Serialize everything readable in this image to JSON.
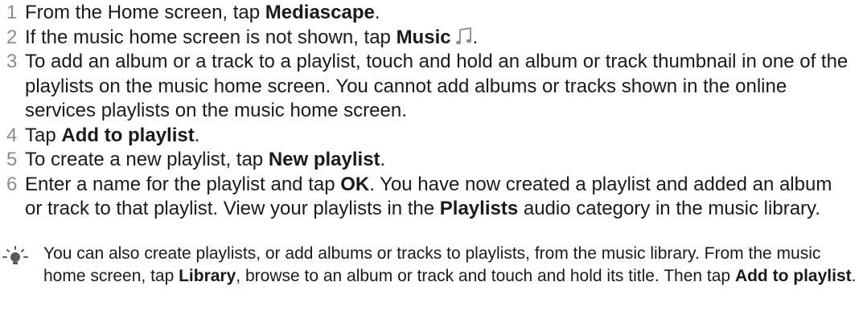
{
  "steps": [
    {
      "num": "1",
      "parts": [
        {
          "t": "From the Home screen, tap "
        },
        {
          "t": "Mediascape",
          "b": true
        },
        {
          "t": "."
        }
      ]
    },
    {
      "num": "2",
      "parts": [
        {
          "t": "If the music home screen is not shown, tap "
        },
        {
          "t": "Music",
          "b": true
        },
        {
          "icon": "music-note-icon"
        },
        {
          "t": "."
        }
      ]
    },
    {
      "num": "3",
      "parts": [
        {
          "t": "To add an album or a track to a playlist, touch and hold an album or track thumbnail in one of the playlists on the music home screen. You cannot add albums or tracks shown in the online services playlists on the music home screen."
        }
      ]
    },
    {
      "num": "4",
      "parts": [
        {
          "t": "Tap "
        },
        {
          "t": "Add to playlist",
          "b": true
        },
        {
          "t": "."
        }
      ]
    },
    {
      "num": "5",
      "parts": [
        {
          "t": "To create a new playlist, tap "
        },
        {
          "t": "New playlist",
          "b": true
        },
        {
          "t": "."
        }
      ]
    },
    {
      "num": "6",
      "parts": [
        {
          "t": "Enter a name for the playlist and tap "
        },
        {
          "t": "OK",
          "b": true
        },
        {
          "t": ". You have now created a playlist and added an album or track to that playlist. View your playlists in the "
        },
        {
          "t": "Playlists",
          "b": true
        },
        {
          "t": " audio category in the music library."
        }
      ]
    }
  ],
  "tip": {
    "icon": "lightbulb-tip-icon",
    "parts": [
      {
        "t": "You can also create playlists, or add albums or tracks to playlists, from the music library. From the music home screen, tap "
      },
      {
        "t": "Library",
        "b": true
      },
      {
        "t": ", browse to an album or track and touch and hold its title. Then tap "
      },
      {
        "t": "Add to playlist",
        "b": true
      },
      {
        "t": "."
      }
    ]
  }
}
